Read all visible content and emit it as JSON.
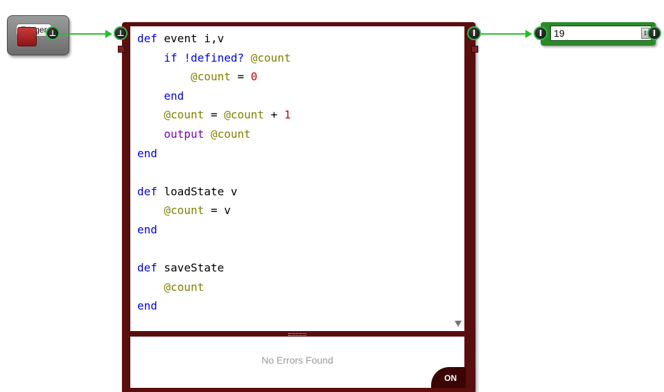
{
  "trigger": {
    "label": "Trigger",
    "output_pin": "⊥"
  },
  "ruby_module": {
    "input_pin": "⊥",
    "output_pin": "I",
    "code_lines": [
      "def event i,v",
      "    if !defined? @count",
      "        @count = 0",
      "    end",
      "    @count = @count + 1",
      "    output @count",
      "end",
      "",
      "def loadState v",
      "    @count = v",
      "end",
      "",
      "def saveState",
      "    @count",
      "end"
    ],
    "error_status": "No Errors Found",
    "toggle_label": "ON"
  },
  "value_box": {
    "input_pin": "I",
    "output_pin": "I",
    "value": "19"
  },
  "colors": {
    "wire": "#25c02f",
    "ruby_frame": "#5a0e0e",
    "value_frame": "#2a8a2a",
    "keyword": "#0000e6",
    "instance_var": "#808000",
    "number": "#cc0000",
    "method": "#7f00b2"
  }
}
